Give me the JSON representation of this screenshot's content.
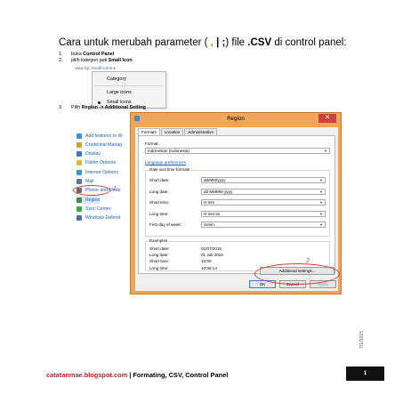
{
  "document": {
    "title_main": "Cara untuk merubah parameter (",
    "title_comma": ",",
    "title_pipe": "|",
    "title_semicolon": ";",
    "title_mid": ") file",
    "title_csv": ".CSV",
    "title_end": "di control panel:",
    "steps": [
      {
        "num": "1.",
        "text": "buka",
        "bold": "Control Panel"
      },
      {
        "num": "2.",
        "text": "pilih kategori jadi",
        "bold": "Small Icon"
      },
      {
        "num": "3.",
        "text": "Pilih",
        "bold": "Region -> Additional Setting"
      }
    ]
  },
  "viewby": {
    "label": "View by:",
    "value": "Small icons ▾",
    "menu": [
      "Category",
      "Large icons",
      "Small icons"
    ]
  },
  "control_panel": {
    "items": [
      {
        "label": "Add features to W",
        "color": "#3c8fd9"
      },
      {
        "label": "Credential Manag",
        "color": "#c9a23a"
      },
      {
        "label": "Display",
        "color": "#3a78c4"
      },
      {
        "label": "Folder Options",
        "color": "#e0b640"
      },
      {
        "label": "Internet Options",
        "color": "#3a9ad6"
      },
      {
        "label": "Mail",
        "color": "#4a7ab8"
      },
      {
        "label": "Phone and Mode",
        "color": "#6a6a6a"
      },
      {
        "label": "Region",
        "color": "#3f8f3f"
      },
      {
        "label": "Sync Center",
        "color": "#3fa64a"
      },
      {
        "label": "Windows Defend",
        "color": "#4a6fb0"
      }
    ],
    "mark_1": "1"
  },
  "dialog": {
    "title": "Region",
    "close": "✕",
    "tabs": [
      "Formats",
      "Location",
      "Administrative"
    ],
    "format_label": "Format:",
    "format_value": "Indonesian (Indonesia)",
    "lang_link": "Language preferences",
    "group_label": "Date and time formats",
    "fields": [
      {
        "label": "Short date:",
        "value": "dd/MM/yyyy"
      },
      {
        "label": "Long date:",
        "value": "dd MMMM yyyy"
      },
      {
        "label": "Short time:",
        "value": "H:mm"
      },
      {
        "label": "Long time:",
        "value": "H:mm:ss"
      },
      {
        "label": "First day of week:",
        "value": "Senin"
      }
    ],
    "examples_label": "Examples",
    "examples": [
      {
        "label": "Short date:",
        "value": "01/07/2015"
      },
      {
        "label": "Long date:",
        "value": "01 Juli 2015"
      },
      {
        "label": "Short time:",
        "value": "10:56"
      },
      {
        "label": "Long time:",
        "value": "10:56:14"
      }
    ],
    "additional_btn": "Additional settings...",
    "ok_btn": "OK",
    "cancel_btn": "Cancel",
    "apply_btn": "Apply",
    "mark_2": "2"
  },
  "side_date": "7/1/2015",
  "footer": {
    "site": "catatanmae.blogspot.com",
    "rest": " | Formating, CSV, Control Panel",
    "page": "1"
  }
}
